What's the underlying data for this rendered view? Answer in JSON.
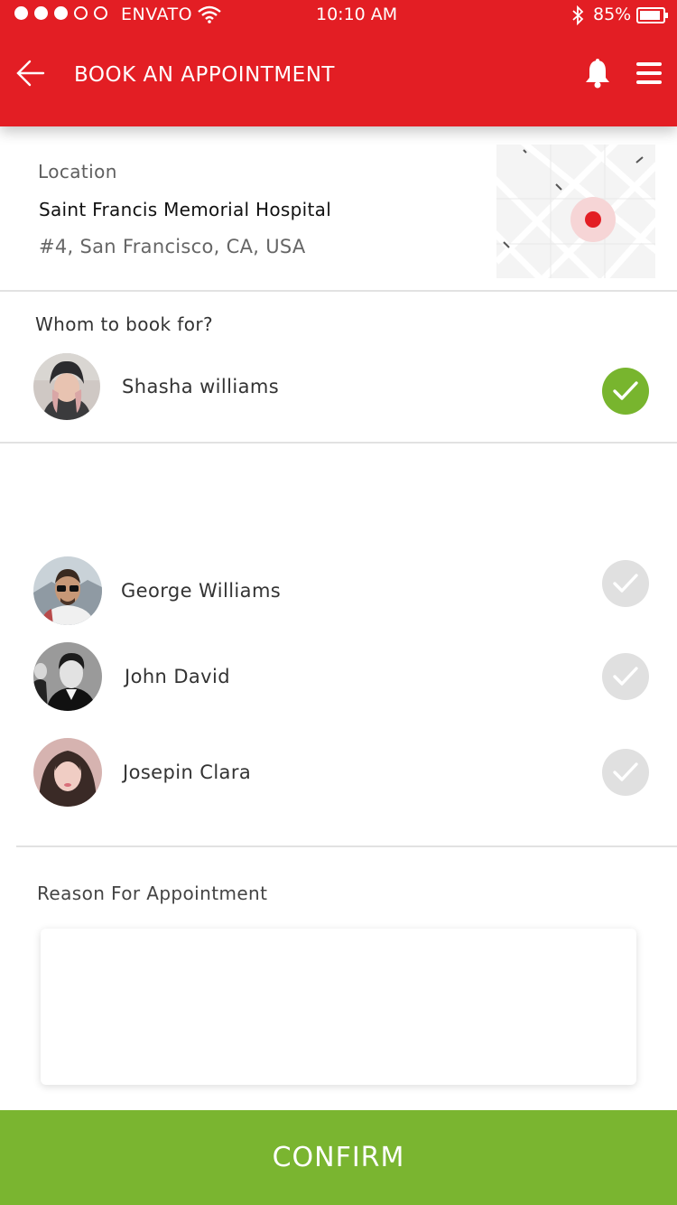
{
  "status_bar": {
    "carrier": "ENVATO",
    "time": "10:10 AM",
    "battery": "85%"
  },
  "header": {
    "title": "BOOK AN APPOINTMENT",
    "back_icon": "arrow-left-icon",
    "bell_icon": "bell-icon",
    "menu_icon": "hamburger-menu-icon",
    "color": "#e31e24"
  },
  "location": {
    "label": "Location",
    "name": "Saint Francis Memorial Hospital",
    "address": "#4, San Francisco, CA, USA",
    "map_icon": "map-pin-icon"
  },
  "book_for": {
    "question": "Whom to book for?",
    "selected": {
      "name": "Shasha williams",
      "checked": true
    },
    "others": [
      {
        "name": "George Williams",
        "checked": false
      },
      {
        "name": "John David",
        "checked": false
      },
      {
        "name": "Josepin Clara",
        "checked": false
      }
    ]
  },
  "reason": {
    "label": "Reason For Appointment",
    "placeholder": ""
  },
  "confirm": {
    "label": "CONFIRM",
    "color": "#7ab530"
  },
  "accent_check_color": "#78b52e"
}
